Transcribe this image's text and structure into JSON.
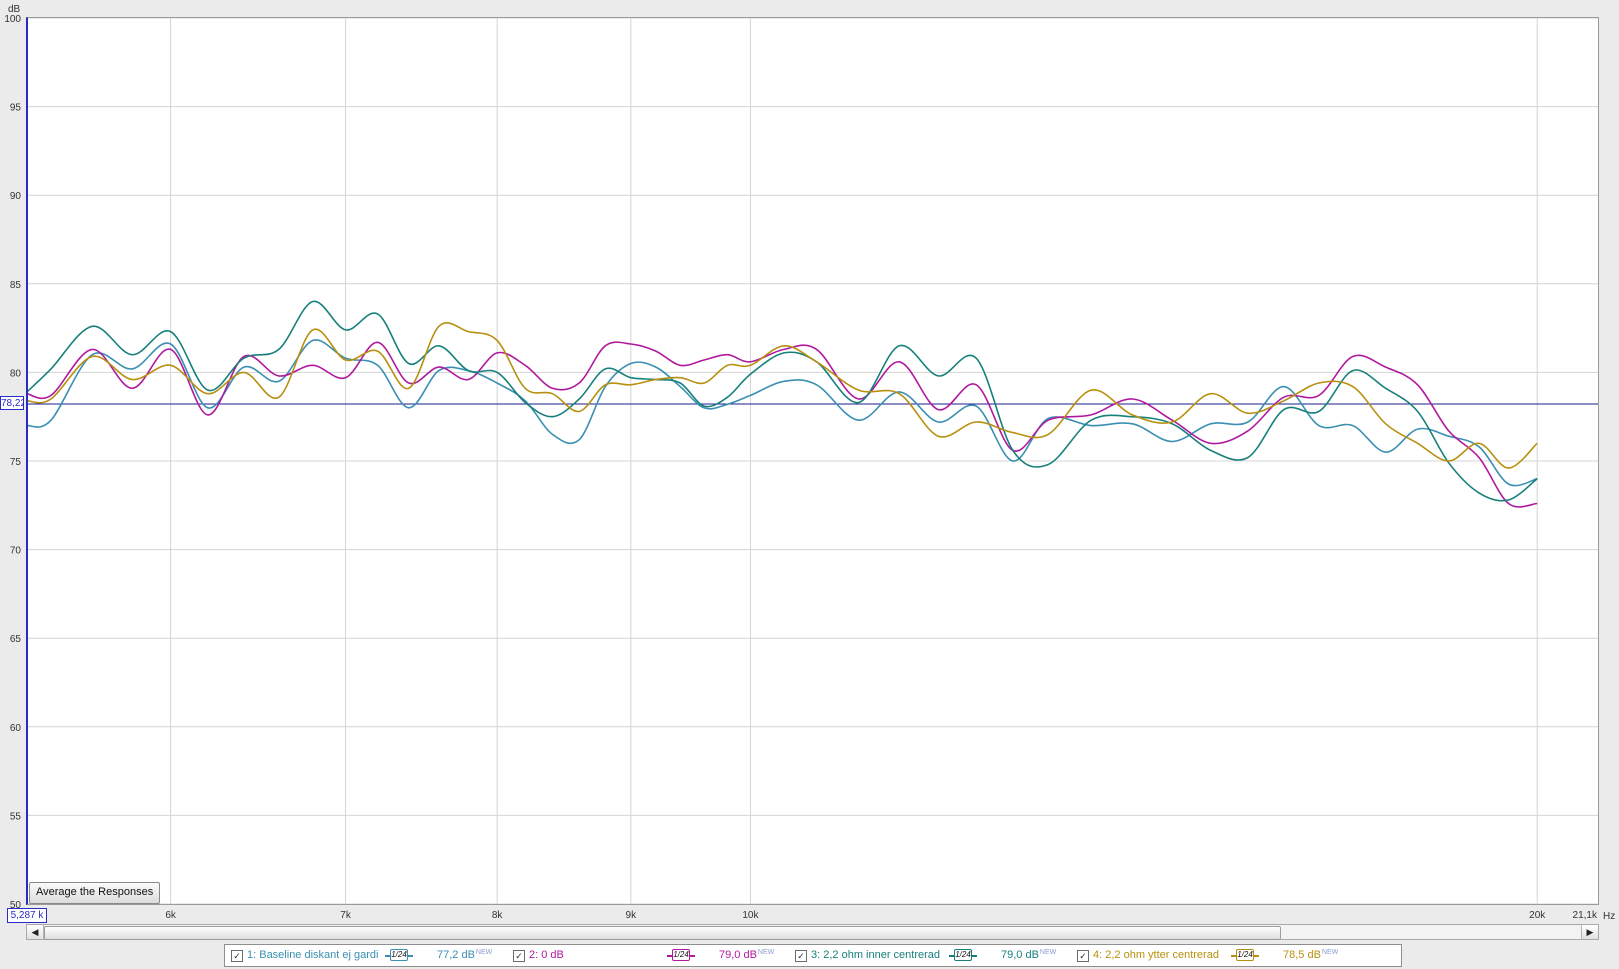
{
  "chart_data": {
    "type": "line",
    "y_unit": "dB",
    "x_unit": "Hz",
    "ylim": [
      50,
      100
    ],
    "xlim": [
      5287,
      21100
    ],
    "x_scale": "log",
    "y_ticks": [
      100,
      95,
      90,
      85,
      80,
      75,
      70,
      65,
      60,
      55,
      50
    ],
    "x_ticks": [
      {
        "value": 6000,
        "label": "6k"
      },
      {
        "value": 7000,
        "label": "7k"
      },
      {
        "value": 8000,
        "label": "8k"
      },
      {
        "value": 9000,
        "label": "9k"
      },
      {
        "value": 10000,
        "label": "10k"
      },
      {
        "value": 20000,
        "label": "20k"
      },
      {
        "value": 21100,
        "label": "21,1k"
      }
    ],
    "grid": true,
    "reference_level": 78.22,
    "series": [
      {
        "name": "1: Baseline diskant ej gardi",
        "color": "#3a8fb2",
        "x": [
          5287,
          5400,
          5600,
          5800,
          6000,
          6200,
          6400,
          6600,
          6800,
          7000,
          7200,
          7400,
          7600,
          7800,
          8000,
          8200,
          8400,
          8600,
          8800,
          9000,
          9200,
          9400,
          9600,
          9800,
          10000,
          10300,
          10600,
          11000,
          11400,
          11800,
          12200,
          12600,
          13000,
          13500,
          14000,
          14500,
          15000,
          15500,
          16000,
          16500,
          17000,
          17500,
          18000,
          18500,
          19000,
          19500,
          20000
        ],
        "y": [
          77.0,
          77.3,
          81.0,
          80.2,
          81.6,
          78.0,
          80.3,
          79.5,
          81.8,
          80.8,
          80.4,
          78.0,
          80.1,
          80.1,
          79.4,
          78.4,
          76.5,
          76.2,
          79.2,
          80.5,
          80.3,
          79.2,
          78.0,
          78.2,
          78.7,
          79.5,
          79.3,
          77.3,
          78.9,
          77.2,
          78.1,
          75.0,
          77.4,
          77.0,
          77.1,
          76.1,
          77.1,
          77.2,
          79.2,
          77.0,
          77.0,
          75.5,
          76.8,
          76.4,
          75.8,
          73.7,
          74.0
        ]
      },
      {
        "name": "2: 0 dB",
        "color": "#b0199f",
        "x": [
          5287,
          5400,
          5600,
          5800,
          6000,
          6200,
          6400,
          6600,
          6800,
          7000,
          7200,
          7400,
          7600,
          7800,
          8000,
          8200,
          8400,
          8600,
          8800,
          9000,
          9200,
          9400,
          9600,
          9800,
          10000,
          10300,
          10600,
          11000,
          11400,
          11800,
          12200,
          12600,
          13000,
          13500,
          14000,
          14500,
          15000,
          15500,
          16000,
          16500,
          17000,
          17500,
          18000,
          18500,
          19000,
          19500,
          20000
        ],
        "y": [
          78.8,
          78.7,
          81.3,
          79.1,
          81.3,
          77.6,
          80.9,
          79.8,
          80.4,
          79.7,
          81.7,
          79.4,
          80.3,
          79.6,
          81.1,
          80.4,
          79.1,
          79.4,
          81.5,
          81.6,
          81.2,
          80.4,
          80.7,
          81.0,
          80.6,
          81.3,
          81.3,
          78.5,
          80.6,
          77.9,
          79.3,
          75.6,
          77.3,
          77.6,
          78.5,
          77.3,
          76.0,
          76.7,
          78.6,
          78.7,
          80.9,
          80.3,
          79.3,
          76.7,
          75.2,
          72.6,
          72.6
        ]
      },
      {
        "name": "3: 2,2 ohm inner centrerad",
        "color": "#17807c",
        "x": [
          5287,
          5400,
          5600,
          5800,
          6000,
          6200,
          6400,
          6600,
          6800,
          7000,
          7200,
          7400,
          7600,
          7800,
          8000,
          8200,
          8400,
          8600,
          8800,
          9000,
          9200,
          9400,
          9600,
          9800,
          10000,
          10300,
          10600,
          11000,
          11400,
          11800,
          12200,
          12600,
          13000,
          13500,
          14000,
          14500,
          15000,
          15500,
          16000,
          16500,
          17000,
          17500,
          18000,
          18500,
          19000,
          19500,
          20000
        ],
        "y": [
          78.9,
          80.2,
          82.6,
          81.0,
          82.3,
          79.0,
          80.8,
          81.3,
          84.0,
          82.4,
          83.3,
          80.5,
          81.5,
          80.1,
          80.0,
          78.3,
          77.5,
          78.5,
          80.2,
          79.7,
          79.6,
          79.4,
          78.1,
          78.6,
          79.9,
          81.1,
          80.6,
          78.3,
          81.5,
          79.8,
          80.8,
          75.6,
          74.8,
          77.3,
          77.5,
          77.1,
          75.6,
          75.2,
          77.9,
          77.8,
          80.1,
          79.1,
          77.8,
          74.9,
          73.2,
          72.8,
          74.0
        ]
      },
      {
        "name": "4: 2,2 ohm ytter centrerad",
        "color": "#b8900f",
        "x": [
          5287,
          5400,
          5600,
          5800,
          6000,
          6200,
          6400,
          6600,
          6800,
          7000,
          7200,
          7400,
          7600,
          7800,
          8000,
          8200,
          8400,
          8600,
          8800,
          9000,
          9200,
          9400,
          9600,
          9800,
          10000,
          10300,
          10600,
          11000,
          11400,
          11800,
          12200,
          12600,
          13000,
          13500,
          14000,
          14500,
          15000,
          15500,
          16000,
          16500,
          17000,
          17500,
          18000,
          18500,
          19000,
          19500,
          20000
        ],
        "y": [
          78.4,
          78.5,
          80.9,
          79.6,
          80.4,
          78.8,
          80.0,
          78.6,
          82.4,
          80.7,
          81.2,
          79.1,
          82.6,
          82.3,
          81.8,
          79.1,
          78.8,
          77.8,
          79.3,
          79.3,
          79.6,
          79.7,
          79.4,
          80.4,
          80.4,
          81.5,
          80.6,
          79.0,
          78.8,
          76.4,
          77.2,
          76.6,
          76.5,
          79.0,
          77.6,
          77.2,
          78.8,
          77.7,
          78.4,
          79.4,
          79.2,
          77.1,
          76.0,
          75.0,
          76.0,
          74.6,
          76.0
        ]
      }
    ]
  },
  "ui": {
    "y_unit_label": "dB",
    "x_unit_label": "Hz",
    "average_button_label": "Average the Responses",
    "cursor_freq_readout": "5,287 k",
    "cursor_level_readout": "78,22",
    "scroll_left_glyph": "◀",
    "scroll_right_glyph": "▶",
    "legend": [
      {
        "name": "1: Baseline diskant ej gardi",
        "color": "#3a8fb2",
        "smoothing": "1/24",
        "level": "77,2 dB",
        "tag": "NEW",
        "checked": "✓"
      },
      {
        "name": "2: 0 dB",
        "color": "#b0199f",
        "smoothing": "1/24",
        "level": "79,0 dB",
        "tag": "NEW",
        "checked": "✓"
      },
      {
        "name": "3: 2,2 ohm inner centrerad",
        "color": "#17807c",
        "smoothing": "1/24",
        "level": "79,0 dB",
        "tag": "NEW",
        "checked": "✓"
      },
      {
        "name": "4: 2,2 ohm ytter centrerad",
        "color": "#b8900f",
        "smoothing": "1/24",
        "level": "78,5 dB",
        "tag": "NEW",
        "checked": "✓"
      }
    ]
  }
}
